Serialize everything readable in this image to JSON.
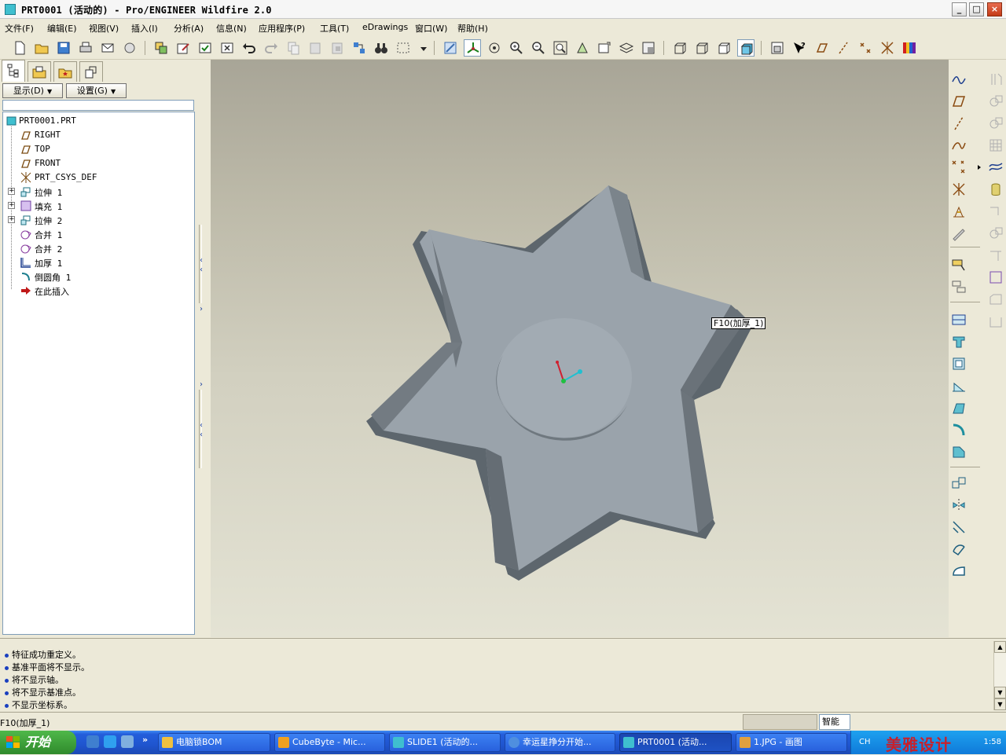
{
  "window": {
    "title": "PRT0001 (活动的) - Pro/ENGINEER Wildfire 2.0",
    "controls": [
      "_",
      "□",
      "×"
    ]
  },
  "menu": [
    "文件(F)",
    "编辑(E)",
    "视图(V)",
    "插入(I)",
    "分析(A)",
    "信息(N)",
    "应用程序(P)",
    "工具(T)",
    "eDrawings",
    "窗口(W)",
    "帮助(H)"
  ],
  "nav": {
    "show_button": "显示(D)",
    "settings_button": "设置(G)",
    "tree": [
      {
        "label": "PRT0001.PRT",
        "icon": "part-icon"
      },
      {
        "label": "RIGHT",
        "icon": "datum-plane-icon"
      },
      {
        "label": "TOP",
        "icon": "datum-plane-icon"
      },
      {
        "label": "FRONT",
        "icon": "datum-plane-icon"
      },
      {
        "label": "PRT_CSYS_DEF",
        "icon": "csys-icon"
      },
      {
        "label": "拉伸 1",
        "icon": "extrude-icon",
        "expandable": true
      },
      {
        "label": "填充 1",
        "icon": "fill-icon",
        "expandable": true
      },
      {
        "label": "拉伸 2",
        "icon": "extrude-icon",
        "expandable": true
      },
      {
        "label": "合并 1",
        "icon": "merge-icon"
      },
      {
        "label": "合并 2",
        "icon": "merge-icon"
      },
      {
        "label": "加厚 1",
        "icon": "thicken-icon"
      },
      {
        "label": "倒圆角 1",
        "icon": "round-icon"
      },
      {
        "label": "在此插入",
        "icon": "insert-here-arrow-icon"
      }
    ]
  },
  "viewport": {
    "tooltip": "F10(加厚_1)",
    "model": "six-pointed star shell with circular boss"
  },
  "messages": [
    "特征成功重定义。",
    "基准平面将不显示。",
    "将不显示轴。",
    "将不显示基准点。",
    "不显示坐标系。"
  ],
  "status": {
    "feature": "F10(加厚_1)",
    "filter": "智能"
  },
  "taskbar": {
    "start": "开始",
    "tasks": [
      {
        "label": "电脑锁BOM",
        "color": "#f0c040"
      },
      {
        "label": "CubeByte - Mic...",
        "color": "#f0a020"
      },
      {
        "label": "SLIDE1 (活动的...",
        "color": "#3fbfcf"
      },
      {
        "label": "幸运星挣分开始...",
        "color": "#4f8fdf"
      },
      {
        "label": "PRT0001 (活动...",
        "color": "#3fbfcf",
        "active": true
      },
      {
        "label": "1.JPG - 画图",
        "color": "#e0a040"
      }
    ],
    "tray_brand": "美雅设计",
    "tray_lang": "CH",
    "tray_clock": "1:58"
  },
  "colors": {
    "viewport_top": "#a8a597",
    "viewport_bottom": "#e4e3d4",
    "model_face": "#9aa3ab",
    "model_shadow": "#5d666d",
    "taskbar": "#245edb"
  }
}
